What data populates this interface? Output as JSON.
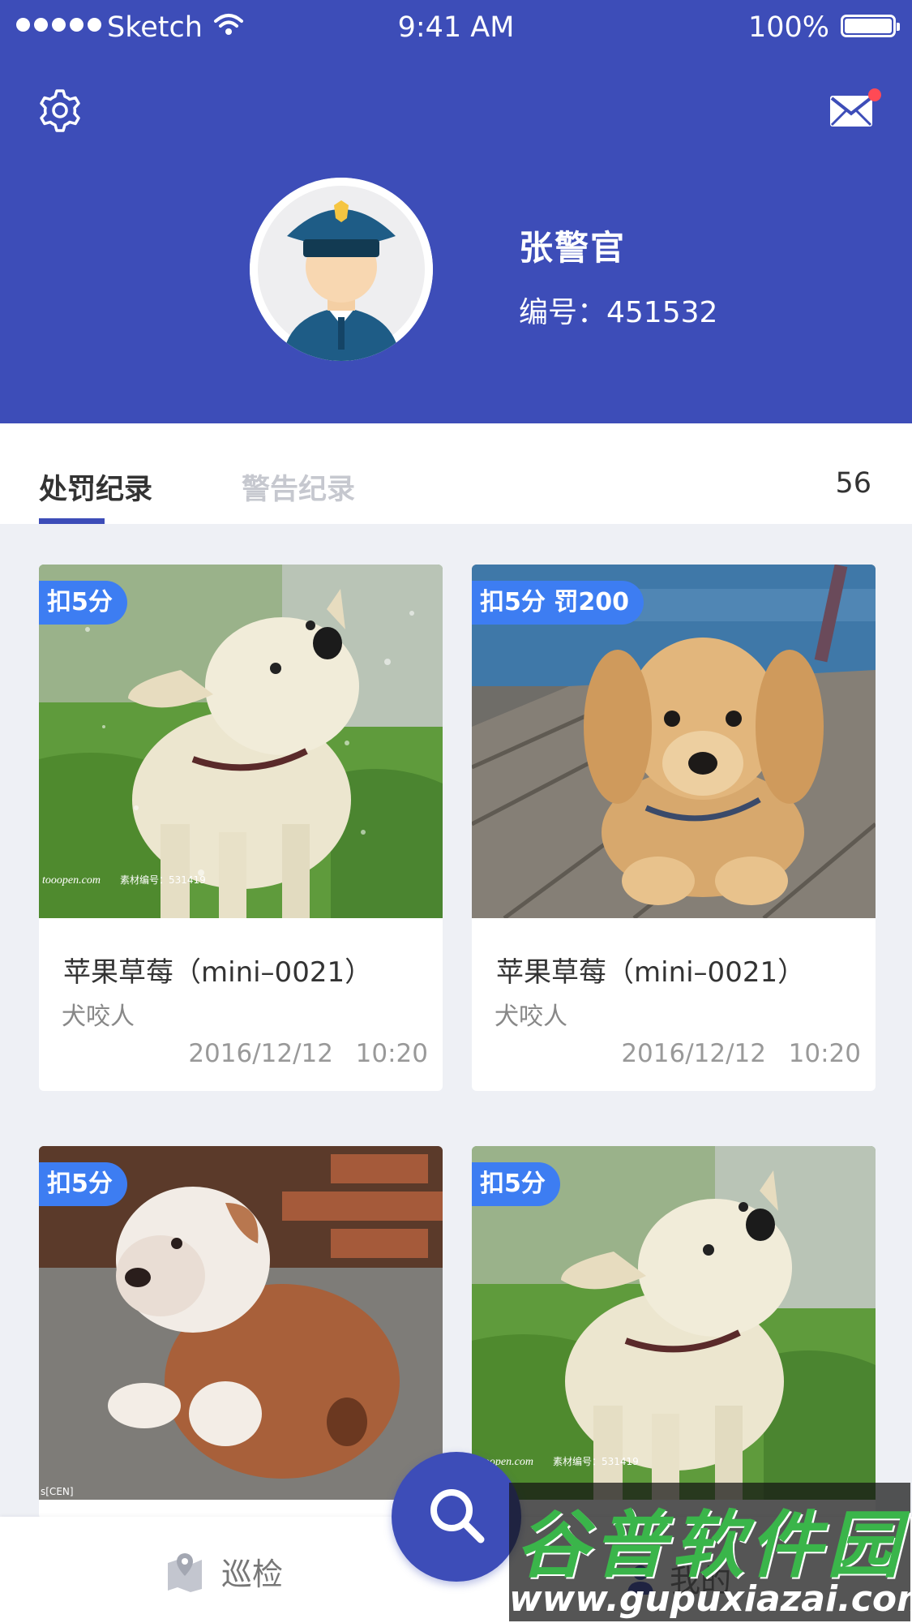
{
  "status_bar": {
    "carrier": "Sketch",
    "time": "9:41 AM",
    "battery": "100%"
  },
  "header": {
    "settings_icon": "gear-icon",
    "mail_icon": "mail-icon",
    "officer_name": "张警官",
    "officer_id": "编号：451532"
  },
  "tabs": {
    "active": "处罚纪录",
    "inactive": "警告纪录",
    "count": "56"
  },
  "cards": [
    {
      "badge": "扣5分",
      "title": "苹果草莓（mini–0021）",
      "subtitle": "犬咬人",
      "date": "2016/12/12",
      "time": "10:20",
      "image": "wet-white-dog-shaking"
    },
    {
      "badge": "扣5分  罚200",
      "title": "苹果草莓（mini–0021）",
      "subtitle": "犬咬人",
      "date": "2016/12/12",
      "time": "10:20",
      "image": "golden-puppy-on-dock"
    },
    {
      "badge": "扣5分",
      "title": "",
      "subtitle": "",
      "date": "",
      "time": "",
      "image": "bulldog-puppy"
    },
    {
      "badge": "扣5分",
      "title": "",
      "subtitle": "",
      "date": "",
      "time": "",
      "image": "wet-white-dog-shaking"
    }
  ],
  "image_watermark": {
    "site": "tooopen.com",
    "code": "素材编号：531419"
  },
  "bottom_nav": {
    "patrol_label": "巡检",
    "patrol_icon": "map-pin-icon",
    "mine_label": "我的",
    "mine_icon": "person-icon",
    "search_icon": "search-icon"
  },
  "watermark": {
    "title": "谷普软件园",
    "url": "www.gupuxiazai.com"
  },
  "colors": {
    "primary": "#3d4db8",
    "badge": "#3d7df2",
    "notification_dot": "#ff4a55",
    "background": "#eef0f5"
  }
}
